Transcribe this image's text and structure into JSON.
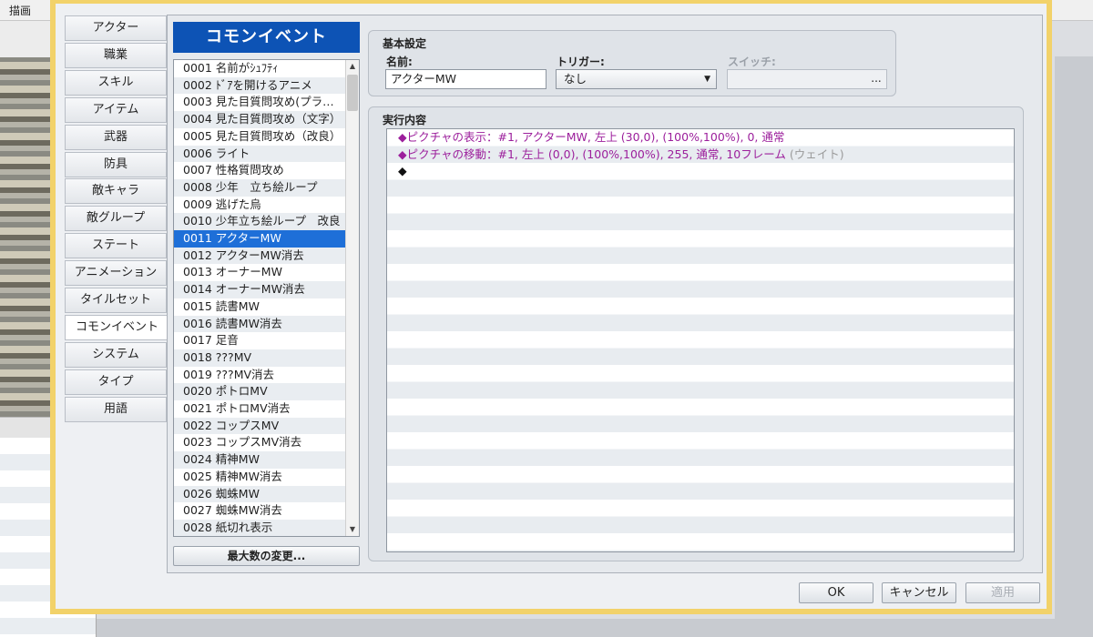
{
  "background": {
    "menu_label": "描画"
  },
  "sidebar": {
    "tabs": [
      "アクター",
      "職業",
      "スキル",
      "アイテム",
      "武器",
      "防具",
      "敵キャラ",
      "敵グループ",
      "ステート",
      "アニメーション",
      "タイルセット",
      "コモンイベント",
      "システム",
      "タイプ",
      "用語"
    ],
    "active_index": 11
  },
  "list": {
    "header": "コモンイベント",
    "items": [
      "0001 名前がｼｭﾌﾃｨ",
      "0002 ﾄﾞｱを開けるアニメ",
      "0003 見た目質問攻め(プラ…",
      "0004 見た目質問攻め（文字）",
      "0005 見た目質問攻め（改良）",
      "0006 ライト",
      "0007 性格質問攻め",
      "0008 少年　立ち絵ループ",
      "0009 逃げた烏",
      "0010 少年立ち絵ループ　改良",
      "0011 アクターMW",
      "0012 アクターMW消去",
      "0013 オーナーMW",
      "0014 オーナーMW消去",
      "0015 読書MW",
      "0016 読書MW消去",
      "0017 足音",
      "0018 ???MV",
      "0019 ???MV消去",
      "0020 ポトロMV",
      "0021 ポトロMV消去",
      "0022 コップスMV",
      "0023 コップスMV消去",
      "0024 精神MW",
      "0025 精神MW消去",
      "0026 蜘蛛MW",
      "0027 蜘蛛MW消去",
      "0028 紙切れ表示"
    ],
    "selected_index": 10,
    "max_button": "最大数の変更..."
  },
  "basic": {
    "title": "基本設定",
    "name_label": "名前:",
    "name_value": "アクターMW",
    "trigger_label": "トリガー:",
    "trigger_value": "なし",
    "switch_label": "スイッチ:",
    "switch_button": "..."
  },
  "exec": {
    "title": "実行内容",
    "commands": [
      {
        "text": "◆ピクチャの表示：#1, アクターMW, 左上 (30,0), (100%,100%), 0, 通常",
        "note": ""
      },
      {
        "text": "◆ピクチャの移動：#1, 左上 (0,0), (100%,100%), 255, 通常, 10フレーム",
        "note": "(ウェイト)"
      },
      {
        "text": "◆",
        "note": ""
      }
    ]
  },
  "footer": {
    "ok": "OK",
    "cancel": "キャンセル",
    "apply": "適用"
  },
  "colors": {
    "header_blue": "#0d53b5",
    "selection": "#1e6fd8",
    "dialog_frame": "#f2d26a",
    "command_text": "#9c1f9c"
  }
}
